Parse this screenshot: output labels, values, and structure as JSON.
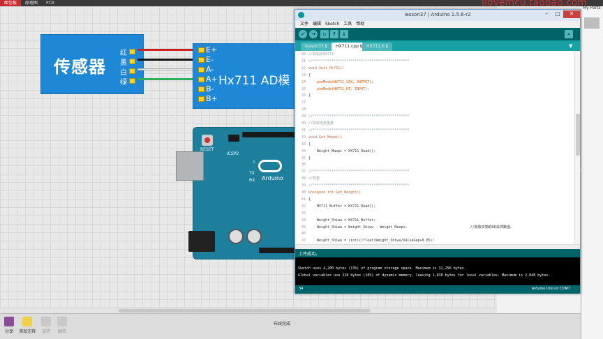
{
  "top_tabs": [
    "面包板",
    "原理图",
    "PCB"
  ],
  "watermark": "Ilovemcu.taobao.com",
  "right_panel_title": "My Parts",
  "sensor": {
    "label": "传感器",
    "wire_colors": [
      "红",
      "黑",
      "白",
      "绿"
    ]
  },
  "hx711": {
    "label": "Hx711 AD模",
    "pins": [
      "E+",
      "E-",
      "A-",
      "A+",
      "B-",
      "B+"
    ]
  },
  "arduino": {
    "reset_label": "RESET",
    "icsp_label": "ICSP2",
    "logo_text": "Arduino",
    "l_label": "L",
    "tx_label": "TX",
    "rx_label": "RX"
  },
  "ide": {
    "title": "lesson37 | Arduino 1.5.6-r2",
    "menus": [
      "文件",
      "编辑",
      "Sketch",
      "工具",
      "帮助"
    ],
    "tabs": [
      "lesson37 §",
      "HX711.cpp §",
      "HX711.h §"
    ],
    "active_tab": 1,
    "code_lines": [
      {
        "n": "20",
        "t": "//初始化HX711",
        "k": "comment"
      },
      {
        "n": "21",
        "t": "//**********************************************",
        "k": "comment"
      },
      {
        "n": "22",
        "t": "void Init_Hx711()",
        "k": "kw"
      },
      {
        "n": "23",
        "t": "{",
        "k": "plain"
      },
      {
        "n": "24",
        "t": "    pinMode(HX711_SCK, OUTPUT);",
        "k": "fn"
      },
      {
        "n": "25",
        "t": "    pinMode(HX711_DT, INPUT);",
        "k": "fn"
      },
      {
        "n": "26",
        "t": "}",
        "k": "plain"
      },
      {
        "n": "27",
        "t": "",
        "k": "plain"
      },
      {
        "n": "28",
        "t": "",
        "k": "plain"
      },
      {
        "n": "29",
        "t": "//**********************************************",
        "k": "comment"
      },
      {
        "n": "30",
        "t": "//获取毛皮重量",
        "k": "comment"
      },
      {
        "n": "31",
        "t": "//**********************************************",
        "k": "comment"
      },
      {
        "n": "32",
        "t": "void Get_Maopi()",
        "k": "kw"
      },
      {
        "n": "33",
        "t": "{",
        "k": "plain"
      },
      {
        "n": "34",
        "t": "    Weight_Maopi = HX711_Read();",
        "k": "plain"
      },
      {
        "n": "35",
        "t": "}",
        "k": "plain"
      },
      {
        "n": "36",
        "t": "",
        "k": "plain"
      },
      {
        "n": "37",
        "t": "//**********************************************",
        "k": "comment"
      },
      {
        "n": "38",
        "t": "//称重",
        "k": "comment"
      },
      {
        "n": "39",
        "t": "//**********************************************",
        "k": "comment"
      },
      {
        "n": "40",
        "t": "unsigned int Get_Weight()",
        "k": "kw"
      },
      {
        "n": "41",
        "t": "{",
        "k": "plain"
      },
      {
        "n": "42",
        "t": "    HX711_Buffer = HX711_Read();",
        "k": "plain"
      },
      {
        "n": "43",
        "t": "",
        "k": "plain"
      },
      {
        "n": "44",
        "t": "    Weight_Shiwu = HX711_Buffer;",
        "k": "plain"
      },
      {
        "n": "45",
        "t": "    Weight_Shiwu = Weight_Shiwu - Weight_Maopi;                              //获取实物的AD采样数值。",
        "k": "plain"
      },
      {
        "n": "46",
        "t": "",
        "k": "plain"
      },
      {
        "n": "47",
        "t": "    Weight_Shiwu = (int)((float)Weight_Shiwu/ValueGap+0.05);",
        "k": "plain"
      }
    ],
    "status": "上传成功。",
    "console": [
      "Sketch uses 4,200 bytes (13%) of program storage space. Maximum is 32,256 bytes.",
      "Global variables use 218 bytes (10%) of dynamic memory, leaving 1,830 bytes for local variables. Maximum is 2,048 bytes."
    ],
    "line_number": "34",
    "board": "Arduino Uno on COM7"
  },
  "bottom": {
    "tools": [
      "分享",
      "添加注释",
      "旋转",
      "翻转"
    ],
    "status": "布线完成"
  }
}
